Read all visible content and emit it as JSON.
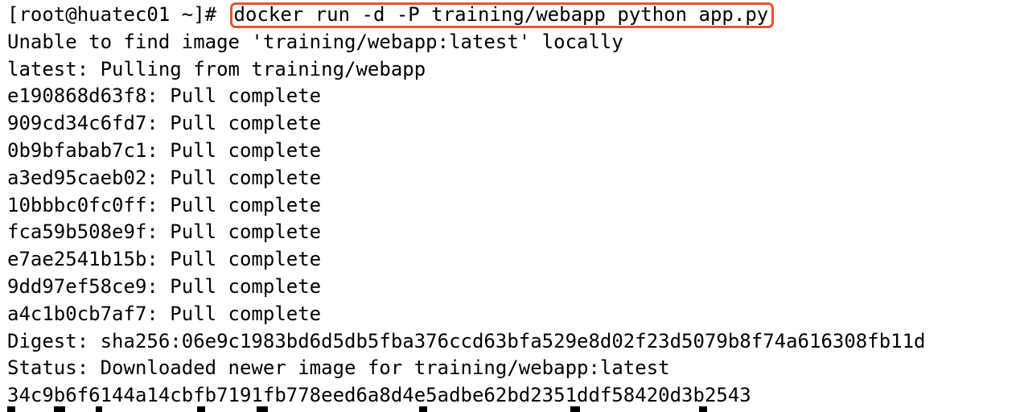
{
  "terminal": {
    "prompt": "[root@huatec01 ~]#",
    "command": "docker run -d -P training/webapp python app.py",
    "highlight_color": "#e8532a",
    "output": [
      "Unable to find image 'training/webapp:latest' locally",
      "latest: Pulling from training/webapp",
      "e190868d63f8: Pull complete",
      "909cd34c6fd7: Pull complete",
      "0b9bfabab7c1: Pull complete",
      "a3ed95caeb02: Pull complete",
      "10bbbc0fc0ff: Pull complete",
      "fca59b508e9f: Pull complete",
      "e7ae2541b15b: Pull complete",
      "9dd97ef58ce9: Pull complete",
      "a4c1b0cb7af7: Pull complete",
      "Digest: sha256:06e9c1983bd6d5db5fba376ccd63bfa529e8d02f23d5079b8f74a616308fb11d",
      "Status: Downloaded newer image for training/webapp:latest",
      "34c9b6f6144a14cbfb7191fb778eed6a8d4e5adbe62bd2351ddf58420d3b2543"
    ]
  }
}
